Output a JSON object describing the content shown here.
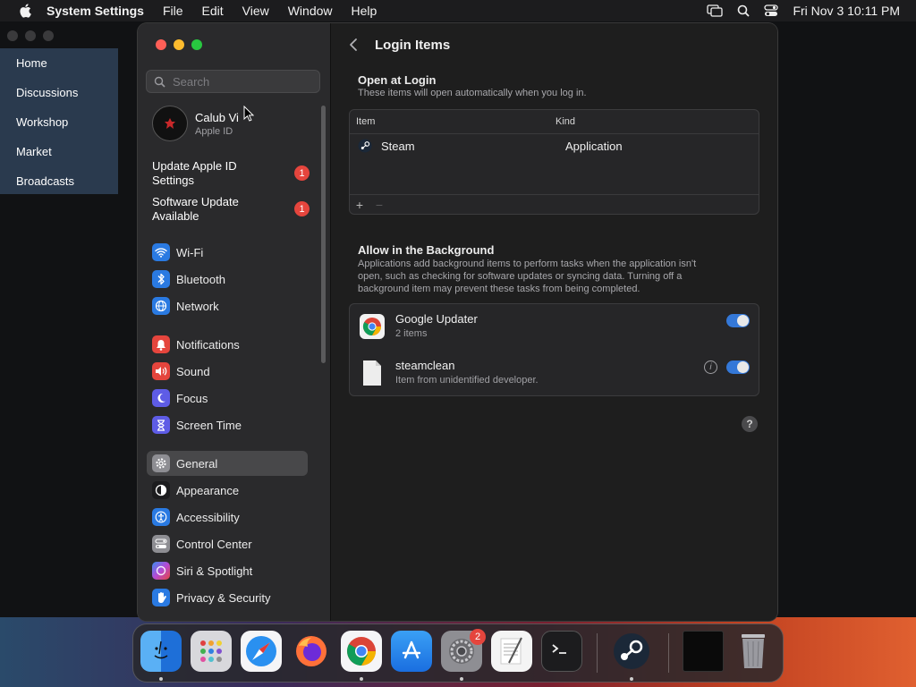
{
  "menubar": {
    "app_name": "System Settings",
    "items": [
      "File",
      "Edit",
      "View",
      "Window",
      "Help"
    ],
    "clock": "Fri Nov 3  10:11 PM"
  },
  "background_window": {
    "nav": [
      "Home",
      "Discussions",
      "Workshop",
      "Market",
      "Broadcasts"
    ]
  },
  "sidebar": {
    "search_placeholder": "Search",
    "account": {
      "name": "Calub Vi",
      "sub": "Apple ID"
    },
    "alerts": [
      {
        "line1": "Update Apple ID",
        "line2": "Settings",
        "badge": "1"
      },
      {
        "line1": "Software Update",
        "line2": "Available",
        "badge": "1"
      }
    ],
    "items": [
      {
        "label": "Wi-Fi",
        "icon": "wifi-icon",
        "color": "#2a7ae2"
      },
      {
        "label": "Bluetooth",
        "icon": "bluetooth-icon",
        "color": "#2a7ae2"
      },
      {
        "label": "Network",
        "icon": "globe-icon",
        "color": "#2a7ae2"
      },
      {
        "label": "Notifications",
        "icon": "bell-icon",
        "color": "#e5453d"
      },
      {
        "label": "Sound",
        "icon": "speaker-icon",
        "color": "#e5453d"
      },
      {
        "label": "Focus",
        "icon": "moon-icon",
        "color": "#5e5ce6"
      },
      {
        "label": "Screen Time",
        "icon": "hourglass-icon",
        "color": "#5e5ce6"
      },
      {
        "label": "General",
        "icon": "gear-icon",
        "color": "#8e8e93"
      },
      {
        "label": "Appearance",
        "icon": "contrast-icon",
        "color": "#1c1c1e"
      },
      {
        "label": "Accessibility",
        "icon": "accessibility-icon",
        "color": "#2a7ae2"
      },
      {
        "label": "Control Center",
        "icon": "switches-icon",
        "color": "#8e8e93"
      },
      {
        "label": "Siri & Spotlight",
        "icon": "siri-icon",
        "color": "#b44ad6"
      },
      {
        "label": "Privacy & Security",
        "icon": "hand-icon",
        "color": "#2a7ae2"
      }
    ],
    "selected": "General"
  },
  "main": {
    "title": "Login Items",
    "open_at_login": {
      "title": "Open at Login",
      "subtitle": "These items will open automatically when you log in.",
      "columns": [
        "Item",
        "Kind"
      ],
      "rows": [
        {
          "item": "Steam",
          "kind": "Application"
        }
      ],
      "add": "+",
      "remove": "−"
    },
    "background": {
      "title": "Allow in the Background",
      "subtitle_lines": [
        "Applications add background items to perform tasks when the application isn't",
        "open, such as checking for software updates or syncing data. Turning off a",
        "background item may prevent these tasks from being completed."
      ],
      "items": [
        {
          "name": "Google Updater",
          "detail": "2 items",
          "enabled": true
        },
        {
          "name": "steamclean",
          "detail": "Item from unidentified developer.",
          "enabled": true
        }
      ]
    },
    "help": "?"
  },
  "dock": {
    "apps": [
      "finder-icon",
      "launchpad-icon",
      "safari-icon",
      "firefox-icon",
      "chrome-icon",
      "app-store-icon",
      "system-settings-icon",
      "textedit-icon",
      "terminal-icon",
      "steam-icon",
      "window-icon",
      "trash-icon"
    ],
    "settings_badge": "2"
  },
  "colors": {
    "accent": "#3478d8",
    "badge": "#e5453d",
    "close": "#ff5f57",
    "minimize": "#febc2e",
    "zoom": "#28c840"
  }
}
